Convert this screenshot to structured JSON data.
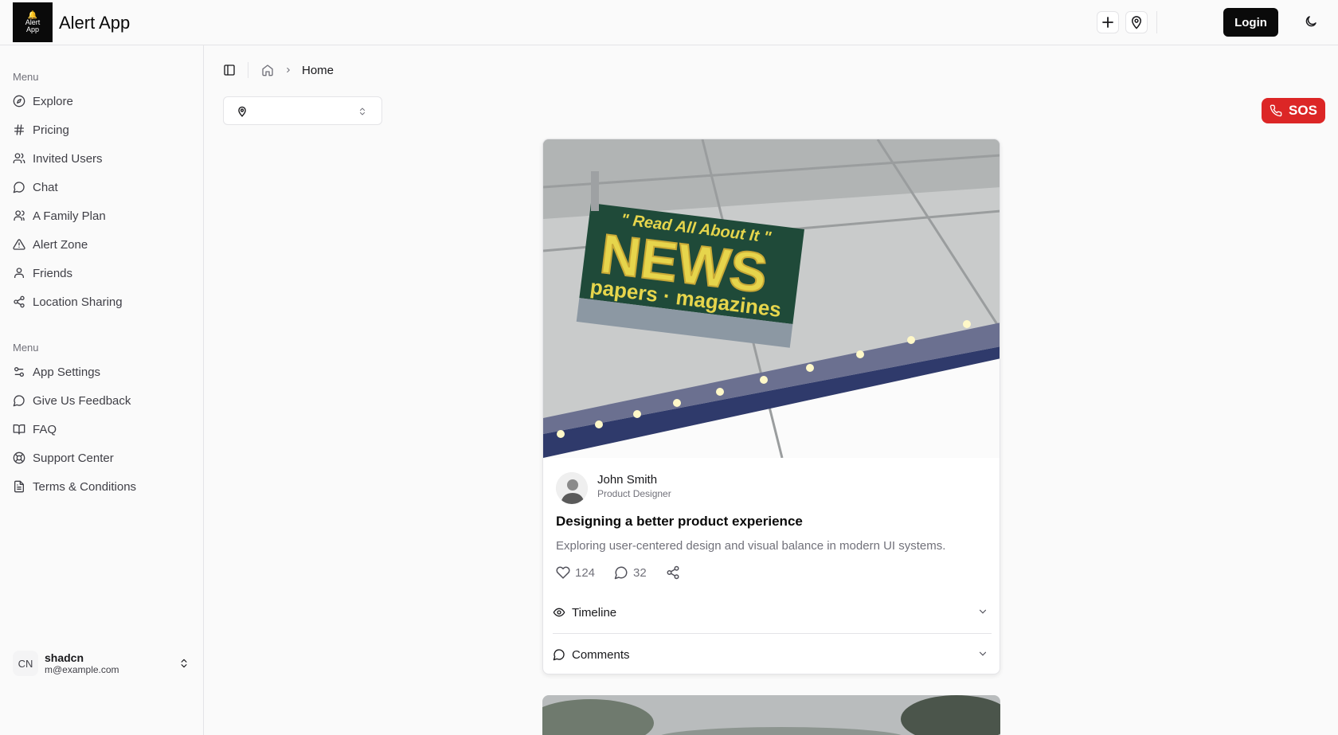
{
  "header": {
    "logo_text_line1": "Alert",
    "logo_text_line2": "App",
    "title": "Alert App",
    "login_label": "Login"
  },
  "sidebar": {
    "group1_label": "Menu",
    "items1": [
      {
        "label": "Explore",
        "icon": "compass-icon"
      },
      {
        "label": "Pricing",
        "icon": "hash-icon"
      },
      {
        "label": "Invited Users",
        "icon": "users-icon"
      },
      {
        "label": "Chat",
        "icon": "chat-icon"
      },
      {
        "label": "A Family Plan",
        "icon": "user-group-icon"
      },
      {
        "label": "Alert Zone",
        "icon": "warning-icon"
      },
      {
        "label": "Friends",
        "icon": "user-icon"
      },
      {
        "label": "Location Sharing",
        "icon": "share-icon"
      }
    ],
    "group2_label": "Menu",
    "items2": [
      {
        "label": "App Settings",
        "icon": "settings-sliders-icon"
      },
      {
        "label": "Give Us Feedback",
        "icon": "chat-icon"
      },
      {
        "label": "FAQ",
        "icon": "book-icon"
      },
      {
        "label": "Support Center",
        "icon": "lifebuoy-icon"
      },
      {
        "label": "Terms & Conditions",
        "icon": "document-icon"
      }
    ],
    "user": {
      "initials": "CN",
      "name": "shadcn",
      "email": "m@example.com"
    }
  },
  "breadcrumb": {
    "current": "Home"
  },
  "sos": {
    "label": "SOS",
    "color": "#dc2626"
  },
  "post": {
    "image_sign": {
      "line1": "\" Read All About It \"",
      "line2": "NEWS",
      "line3": "papers · magazines"
    },
    "author_name": "John Smith",
    "author_role": "Product Designer",
    "title": "Designing a better product experience",
    "description": "Exploring user-centered design and visual balance in modern UI systems.",
    "likes": "124",
    "comments": "32",
    "accordion": [
      {
        "label": "Timeline",
        "icon": "eye-icon"
      },
      {
        "label": "Comments",
        "icon": "chat-icon"
      }
    ]
  }
}
